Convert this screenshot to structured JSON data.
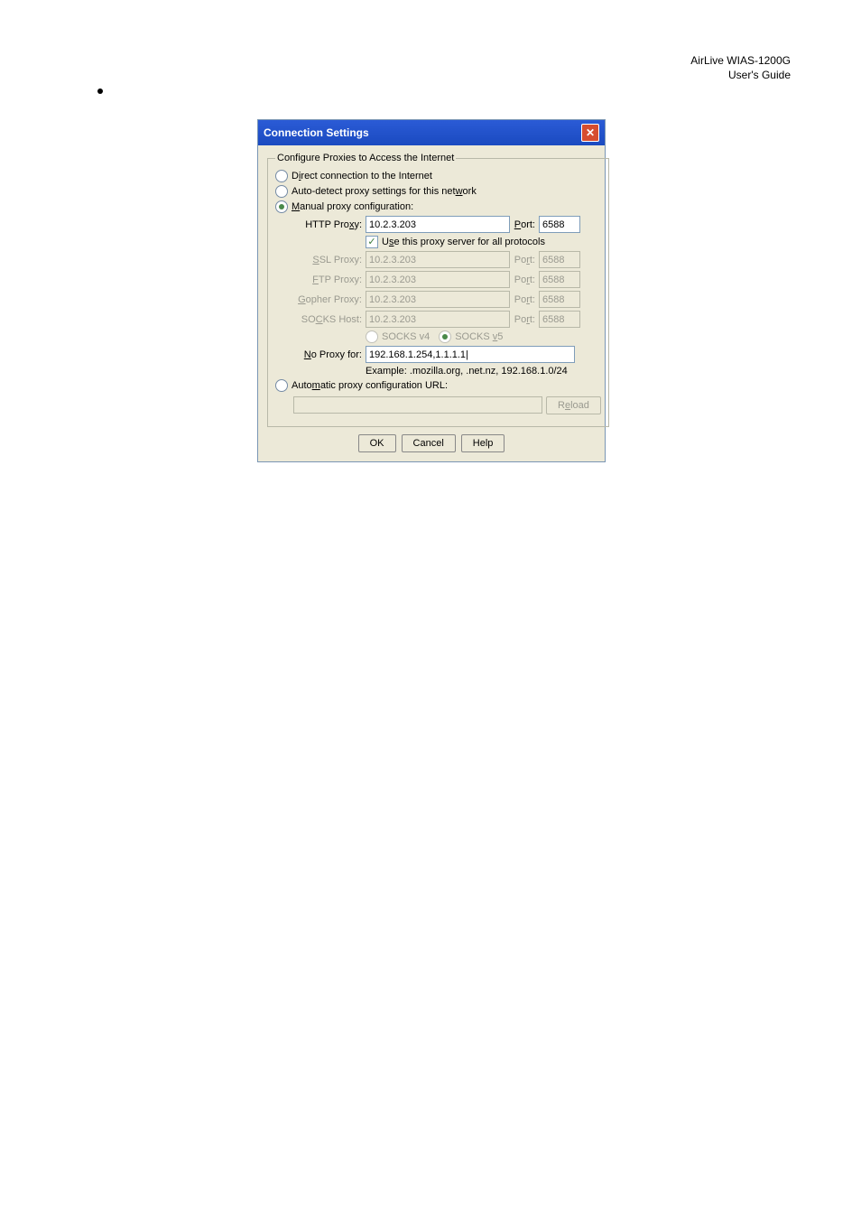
{
  "header": {
    "line1": "AirLive WIAS-1200G",
    "line2": "User's Guide"
  },
  "dialog": {
    "title": "Connection Settings",
    "legend": "Configure Proxies to Access the Internet",
    "radios": {
      "direct_pre": "D",
      "direct_u": "i",
      "direct_post": "rect connection to the Internet",
      "auto_pre": "Auto-detect proxy settings for this net",
      "auto_u": "w",
      "auto_post": "ork",
      "manual_u": "M",
      "manual_post": "anual proxy configuration:",
      "autourl_pre": "Auto",
      "autourl_u": "m",
      "autourl_post": "atic proxy configuration URL:"
    },
    "http": {
      "label_pre": "HTTP Pro",
      "label_u": "x",
      "label_post": "y:",
      "host": "10.2.3.203",
      "port": "6588"
    },
    "useall_pre": "U",
    "useall_u": "s",
    "useall_post": "e this proxy server for all protocols",
    "ssl": {
      "label_u": "S",
      "label_post": "SL Proxy:",
      "host": "10.2.3.203",
      "port": "6588"
    },
    "ftp": {
      "label_u": "F",
      "label_post": "TP Proxy:",
      "host": "10.2.3.203",
      "port": "6588"
    },
    "gopher": {
      "label_u": "G",
      "label_post": "opher Proxy:",
      "host": "10.2.3.203",
      "port": "6588"
    },
    "socks": {
      "label_pre": "SO",
      "label_u": "C",
      "label_post": "KS Host:",
      "host": "10.2.3.203",
      "port": "6588",
      "v4": "SOCKS v4",
      "v5_pre": "SOCKS ",
      "v5_u": "v",
      "v5_post": "5"
    },
    "noproxy": {
      "label_u": "N",
      "label_post": "o Proxy for:",
      "value": "192.168.1.254,1.1.1.1|"
    },
    "example": "Example: .mozilla.org, .net.nz, 192.168.1.0/24",
    "port_label_pre": "",
    "port_label_u": "P",
    "port_label_post": "ort:",
    "port_label_disabled_pre": "Po",
    "port_label_disabled_u": "r",
    "port_label_disabled_post": "t:",
    "buttons": {
      "reload_pre": "R",
      "reload_u": "e",
      "reload_post": "load",
      "ok": "OK",
      "cancel": "Cancel",
      "help": "Help"
    }
  }
}
